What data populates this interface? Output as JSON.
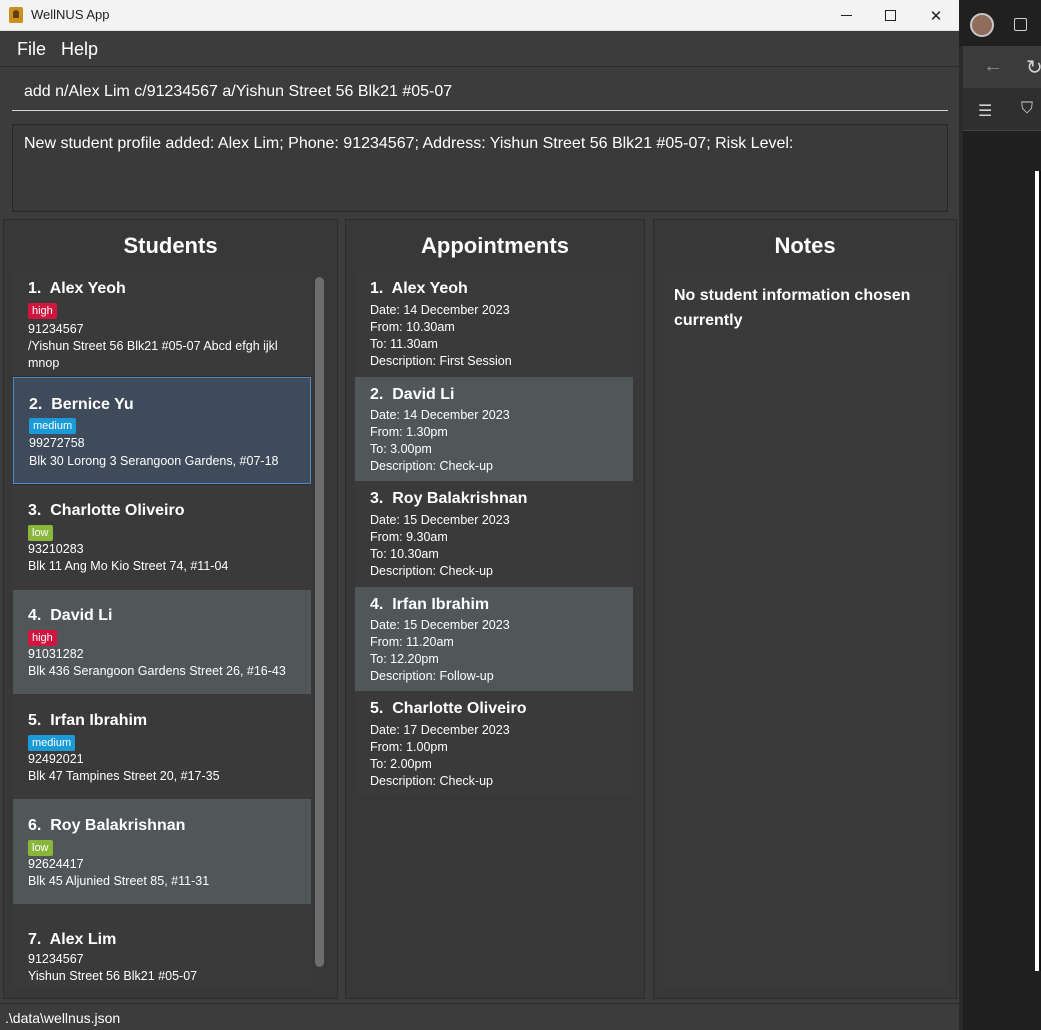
{
  "window": {
    "title": "WellNUS App"
  },
  "menu": {
    "file": "File",
    "help": "Help"
  },
  "command": {
    "value": "add n/Alex Lim c/91234567 a/Yishun Street 56 Blk21 #05-07"
  },
  "result": {
    "text": "New student profile added: Alex Lim; Phone: 91234567; Address: Yishun Street 56 Blk21 #05-07; Risk Level:"
  },
  "students": {
    "title": "Students",
    "items": [
      {
        "index": "1.",
        "name": "Alex Yeoh",
        "risk": "high",
        "phone": "91234567",
        "address_line1": "/Yishun Street 56 Blk21 #05-07 Abcd efgh ijkl",
        "address_line2": "mnop"
      },
      {
        "index": "2.",
        "name": "Bernice Yu",
        "risk": "medium",
        "phone": "99272758",
        "address_line1": "Blk 30 Lorong 3 Serangoon Gardens, #07-18"
      },
      {
        "index": "3.",
        "name": "Charlotte Oliveiro",
        "risk": "low",
        "phone": "93210283",
        "address_line1": "Blk 11 Ang Mo Kio Street 74, #11-04"
      },
      {
        "index": "4.",
        "name": "David Li",
        "risk": "high",
        "phone": "91031282",
        "address_line1": "Blk 436 Serangoon Gardens Street 26, #16-43"
      },
      {
        "index": "5.",
        "name": "Irfan Ibrahim",
        "risk": "medium",
        "phone": "92492021",
        "address_line1": "Blk 47 Tampines Street 20, #17-35"
      },
      {
        "index": "6.",
        "name": "Roy Balakrishnan",
        "risk": "low",
        "phone": "92624417",
        "address_line1": "Blk 45 Aljunied Street 85, #11-31"
      },
      {
        "index": "7.",
        "name": "Alex Lim",
        "phone": "91234567",
        "address_line1": "Yishun Street 56 Blk21 #05-07"
      }
    ]
  },
  "appointments": {
    "title": "Appointments",
    "items": [
      {
        "index": "1.",
        "name": "Alex Yeoh",
        "date": "Date: 14 December 2023",
        "from": "From: 10.30am",
        "to": "To: 11.30am",
        "description": "Description: First Session"
      },
      {
        "index": "2.",
        "name": "David Li",
        "date": "Date: 14 December 2023",
        "from": "From: 1.30pm",
        "to": "To: 3.00pm",
        "description": "Description: Check-up"
      },
      {
        "index": "3.",
        "name": "Roy Balakrishnan",
        "date": "Date: 15 December 2023",
        "from": "From: 9.30am",
        "to": "To: 10.30am",
        "description": "Description: Check-up"
      },
      {
        "index": "4.",
        "name": "Irfan Ibrahim",
        "date": "Date: 15 December 2023",
        "from": "From: 11.20am",
        "to": "To: 12.20pm",
        "description": "Description: Follow-up"
      },
      {
        "index": "5.",
        "name": "Charlotte Oliveiro",
        "date": "Date: 17 December 2023",
        "from": "From: 1.00pm",
        "to": "To: 2.00pm",
        "description": "Description: Check-up"
      }
    ]
  },
  "notes": {
    "title": "Notes",
    "empty_text": "No student information chosen currently"
  },
  "status": {
    "path": ".\\data\\wellnus.json"
  },
  "colors": {
    "risk_high": "#d0163f",
    "risk_medium": "#1a9bd7",
    "risk_low": "#8ab73b",
    "selection_border": "#4d8ac0"
  },
  "icons": {
    "app": "wellnus-app-icon",
    "minimize": "minimize-icon",
    "maximize": "maximize-icon",
    "close": "close-icon"
  }
}
